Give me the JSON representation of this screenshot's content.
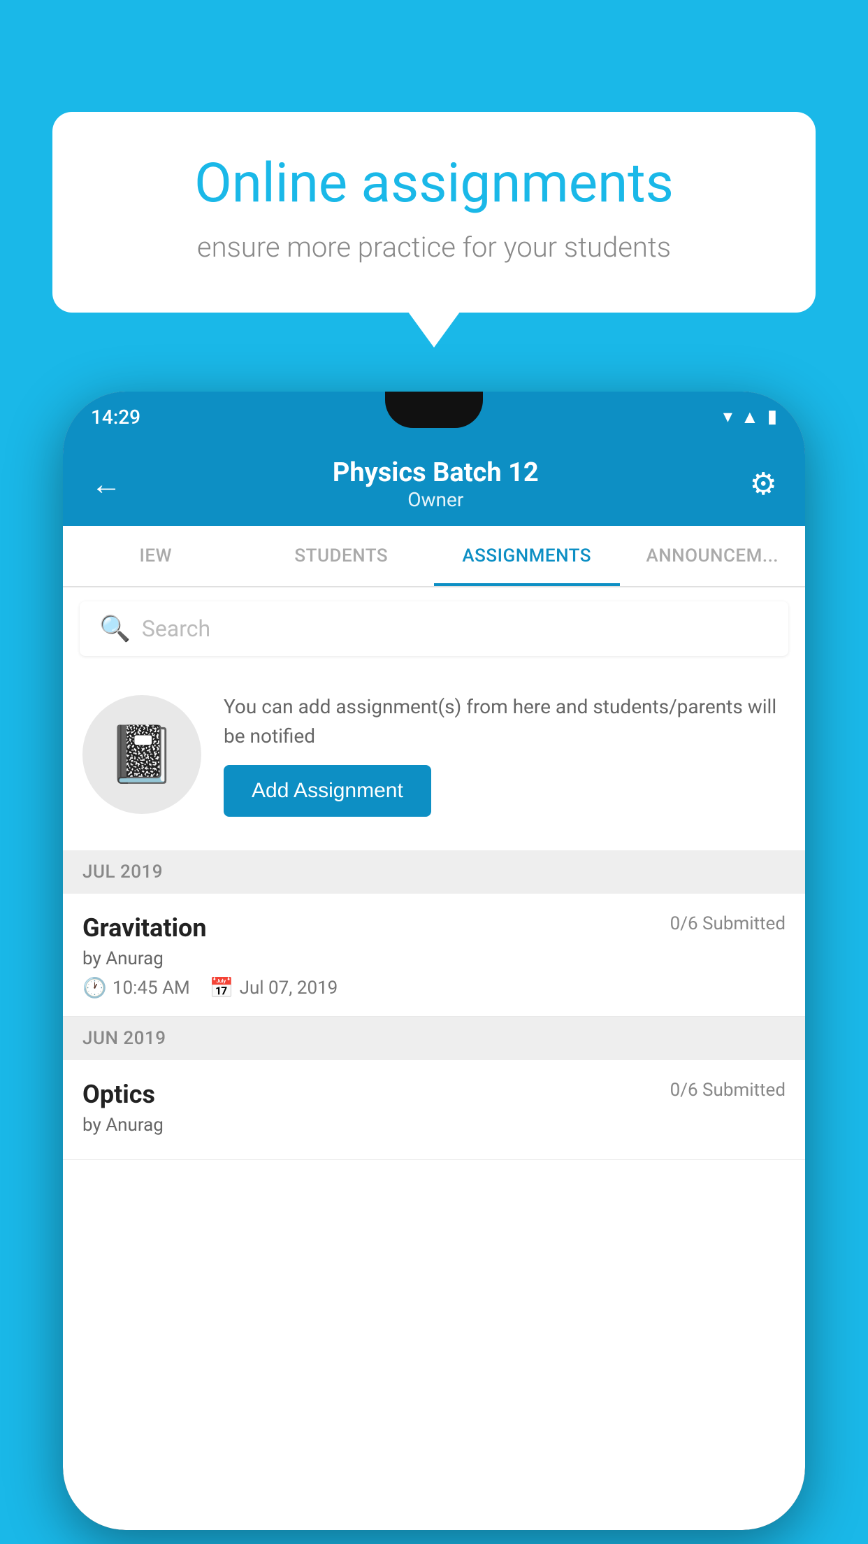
{
  "background_color": "#1ab8e8",
  "info_card": {
    "title": "Online assignments",
    "subtitle": "ensure more practice for your students"
  },
  "status_bar": {
    "time": "14:29",
    "wifi_icon": "▲",
    "signal_icon": "▲",
    "battery_icon": "▮"
  },
  "app_bar": {
    "title": "Physics Batch 12",
    "subtitle": "Owner",
    "back_label": "←",
    "settings_label": "⚙"
  },
  "tabs": [
    {
      "label": "IEW",
      "active": false
    },
    {
      "label": "STUDENTS",
      "active": false
    },
    {
      "label": "ASSIGNMENTS",
      "active": true
    },
    {
      "label": "ANNOUNCEM...",
      "active": false
    }
  ],
  "search": {
    "placeholder": "Search"
  },
  "promo": {
    "description": "You can add assignment(s) from here and students/parents will be notified",
    "add_button_label": "Add Assignment"
  },
  "sections": [
    {
      "header": "JUL 2019",
      "assignments": [
        {
          "title": "Gravitation",
          "submitted": "0/6 Submitted",
          "author": "by Anurag",
          "time": "10:45 AM",
          "date": "Jul 07, 2019"
        }
      ]
    },
    {
      "header": "JUN 2019",
      "assignments": [
        {
          "title": "Optics",
          "submitted": "0/6 Submitted",
          "author": "by Anurag",
          "time": "",
          "date": ""
        }
      ]
    }
  ]
}
